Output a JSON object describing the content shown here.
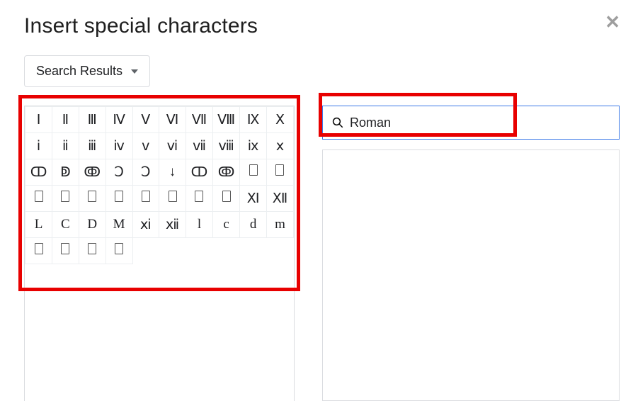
{
  "dialog": {
    "title": "Insert special characters"
  },
  "filter": {
    "label": "Search Results"
  },
  "search": {
    "value": "Roman",
    "placeholder": ""
  },
  "grid": {
    "rows": [
      [
        "Ⅰ",
        "Ⅱ",
        "Ⅲ",
        "Ⅳ",
        "Ⅴ",
        "Ⅵ",
        "Ⅶ",
        "Ⅷ",
        "Ⅸ",
        "Ⅹ"
      ],
      [
        "ⅰ",
        "ⅱ",
        "ⅲ",
        "ⅳ",
        "ⅴ",
        "ⅵ",
        "ⅶ",
        "ⅷ",
        "ⅸ",
        "ⅹ"
      ],
      [
        "ↀ",
        "ↁ",
        "ↂ",
        "Ↄ",
        "Ↄ",
        "↓",
        "ↀ",
        "ↂ",
        "□",
        "□"
      ],
      [
        "□",
        "□",
        "□",
        "□",
        "□",
        "□",
        "□",
        "□",
        "Ⅺ",
        "Ⅻ"
      ],
      [
        "L",
        "C",
        "D",
        "M",
        "ⅺ",
        "ⅻ",
        "l",
        "c",
        "d",
        "m"
      ],
      [
        "□",
        "□",
        "□",
        "□",
        "",
        "",
        "",
        "",
        "",
        ""
      ]
    ]
  },
  "glyph_names": {
    "r0": [
      "roman-one",
      "roman-two",
      "roman-three",
      "roman-four",
      "roman-five",
      "roman-six",
      "roman-seven",
      "roman-eight",
      "roman-nine",
      "roman-ten"
    ],
    "r1": [
      "small-roman-one",
      "small-roman-two",
      "small-roman-three",
      "small-roman-four",
      "small-roman-five",
      "small-roman-six",
      "small-roman-seven",
      "small-roman-eight",
      "small-roman-nine",
      "small-roman-ten"
    ],
    "r2": [
      "roman-one-thousand-cd",
      "roman-five-thousand",
      "roman-ten-thousand",
      "roman-reversed-c",
      "roman-reversed-c-2",
      "downwards-arrow",
      "roman-one-thousand-cd-2",
      "roman-ten-thousand-2",
      "unknown-glyph",
      "unknown-glyph"
    ],
    "r3": [
      "unknown-glyph",
      "unknown-glyph",
      "unknown-glyph",
      "unknown-glyph",
      "unknown-glyph",
      "unknown-glyph",
      "unknown-glyph",
      "unknown-glyph",
      "roman-eleven",
      "roman-twelve"
    ],
    "r4": [
      "roman-fifty",
      "roman-hundred",
      "roman-five-hundred",
      "roman-thousand",
      "small-roman-eleven",
      "small-roman-twelve",
      "small-roman-fifty",
      "small-roman-hundred",
      "small-roman-five-hundred",
      "small-roman-thousand"
    ],
    "r5": [
      "unknown-glyph",
      "unknown-glyph",
      "unknown-glyph",
      "unknown-glyph",
      "",
      "",
      "",
      "",
      "",
      ""
    ]
  }
}
